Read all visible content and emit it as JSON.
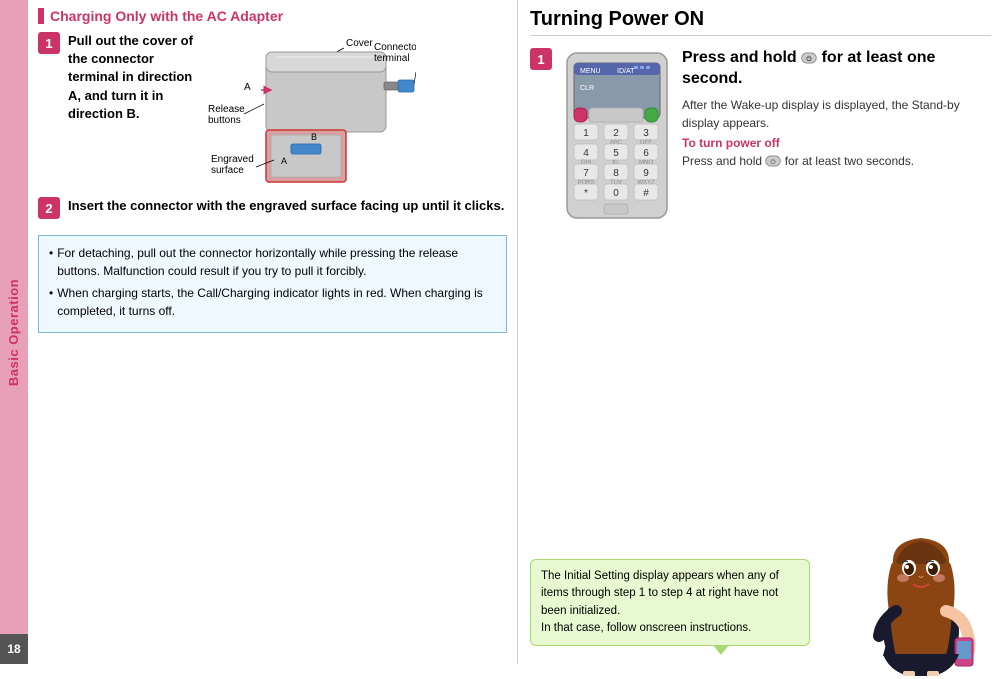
{
  "sidebar": {
    "label": "Basic Operation"
  },
  "page_number": "18",
  "left_section": {
    "title": "Charging Only with the AC Adapter",
    "step1": {
      "number": "1",
      "text": "Pull out the cover of the connector terminal in direction A, and turn it in direction B.",
      "labels": {
        "cover": "Cover",
        "release_buttons": "Release buttons",
        "connector_terminal": "Connector terminal",
        "engraved_surface": "Engraved surface"
      }
    },
    "step2": {
      "number": "2",
      "text": "Insert the connector with the engraved surface facing up until it clicks."
    },
    "notes": [
      "For detaching, pull out the connector horizontally while pressing the release buttons. Malfunction could result if you try to pull it forcibly.",
      "When charging starts, the Call/Charging indicator lights in red. When charging is completed, it turns off."
    ]
  },
  "right_section": {
    "title": "Turning Power ON",
    "step1": {
      "number": "1",
      "heading": "Press and hold       for at least one second.",
      "description": "After the Wake-up display is displayed, the Stand-by display appears.",
      "turn_power_off_label": "To turn power off",
      "turn_power_off_text": "Press and hold       for at least two seconds."
    },
    "speech_bubble": {
      "text": "The Initial Setting display appears when any of items through step 1 to step 4 at right have not been initialized.\nIn that case, follow onscreen instructions."
    }
  }
}
